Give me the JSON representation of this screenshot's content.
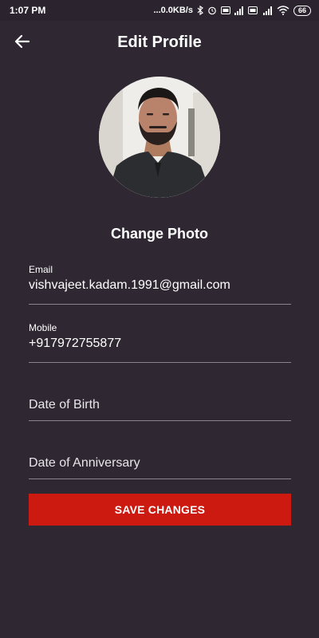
{
  "status_bar": {
    "time": "1:07 PM",
    "network_speed": "...0.0KB/s",
    "battery": "66",
    "icons": [
      "bluetooth-icon",
      "alarm-icon",
      "volte-icon",
      "signal-icon",
      "volte-icon",
      "4g-signal-icon",
      "wifi-icon",
      "battery-icon"
    ]
  },
  "header": {
    "title": "Edit Profile",
    "back_icon": "arrow-left-icon"
  },
  "profile": {
    "change_photo_label": "Change Photo"
  },
  "form": {
    "email": {
      "label": "Email",
      "value": "vishvajeet.kadam.1991@gmail.com"
    },
    "mobile": {
      "label": "Mobile",
      "value": "+917972755877"
    },
    "dob": {
      "placeholder": "Date of Birth"
    },
    "anniversary": {
      "placeholder": "Date of Anniversary"
    }
  },
  "actions": {
    "save_label": "SAVE CHANGES"
  },
  "colors": {
    "background": "#2f2832",
    "accent": "#cc1a10",
    "divider": "#8a8390"
  }
}
